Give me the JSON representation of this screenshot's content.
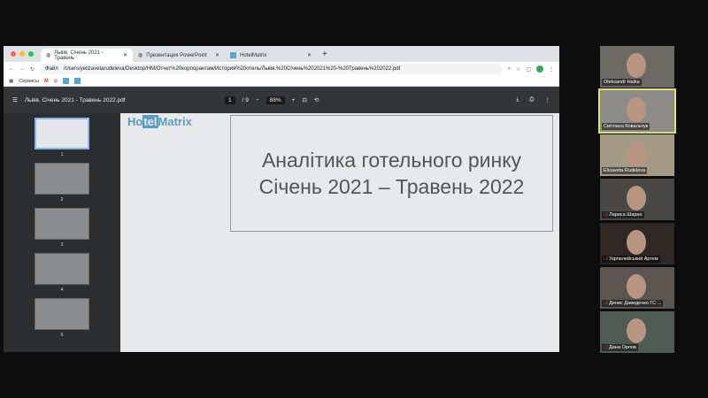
{
  "browser": {
    "tabs": [
      {
        "label": "Львів. Січень 2021 - Травень",
        "active": true
      },
      {
        "label": "Презентация PowerPoint",
        "active": false
      },
      {
        "label": "HotelMatrix",
        "active": false
      }
    ],
    "new_tab": "+",
    "address_prefix": "Файл",
    "url": "/Users/yelizavetarudeleva/Desktop/HM/Отчет%20корпорантам/История%20отель/Львів.%20Січень%202021%20-%20Травень%202022.pdf",
    "bookmarks": [
      "Сервисы"
    ]
  },
  "pdf": {
    "filename": "Львів. Січень 2021 - Травень 2022.pdf",
    "page": "1",
    "total_pages": "/ 9",
    "zoom": "88%",
    "thumbnails": [
      "1",
      "2",
      "3",
      "4",
      "5"
    ],
    "logo": {
      "pre": "Ho",
      "hl": "tel",
      "post": "Matrix"
    },
    "title_line1": "Аналітика готельного ринку",
    "title_line2": "Січень 2021 – Травень 2022"
  },
  "participants": [
    {
      "name": "Oleksandr Haika",
      "muted": false,
      "speaking": false,
      "color": "#6d6a66"
    },
    {
      "name": "Світлана Ковальчук",
      "muted": false,
      "speaking": true,
      "color": "#8e8c88"
    },
    {
      "name": "Elizaveta Rudeleva",
      "muted": false,
      "speaking": false,
      "color": "#a59a85"
    },
    {
      "name": "Лариса Шаран",
      "muted": true,
      "speaking": false,
      "color": "#4a4844"
    },
    {
      "name": "Укрпелейський Артем",
      "muted": true,
      "speaking": false,
      "color": "#2e2724"
    },
    {
      "name": "Денис Давиденко ГС ...",
      "muted": true,
      "speaking": false,
      "color": "#5a5550"
    },
    {
      "name": "Дана Орлов",
      "muted": true,
      "speaking": false,
      "color": "#4f5a52"
    }
  ]
}
